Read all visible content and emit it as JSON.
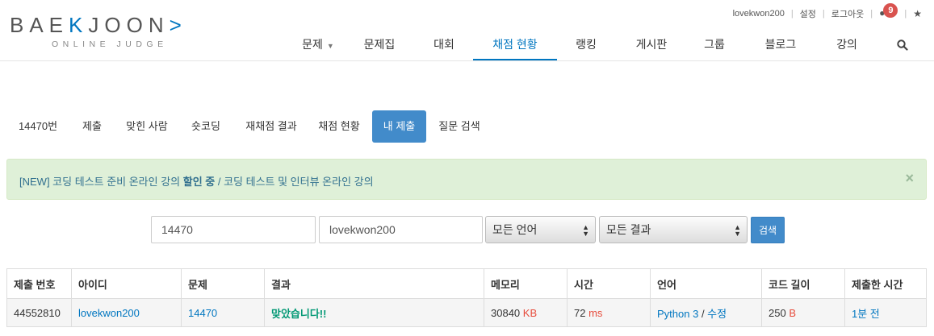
{
  "brand": {
    "logo_left": "BAE",
    "logo_k": "K",
    "logo_right": "JOON",
    "logo_arrow": ">",
    "subtitle": "ONLINE JUDGE"
  },
  "user_bar": {
    "username": "lovekwon200",
    "settings": "설정",
    "logout": "로그아웃",
    "notification_count": "9"
  },
  "nav": {
    "items": [
      "문제",
      "문제집",
      "대회",
      "채점 현황",
      "랭킹",
      "게시판",
      "그룹",
      "블로그",
      "강의"
    ],
    "active": "채점 현황"
  },
  "problem_menu": {
    "items": [
      "14470번",
      "제출",
      "맞힌 사람",
      "숏코딩",
      "재채점 결과",
      "채점 현황",
      "내 제출",
      "질문 검색"
    ],
    "active": "내 제출"
  },
  "alert": {
    "prefix": "[NEW] 코딩 테스트 준비 온라인 강의 ",
    "highlight": "할인 중",
    "suffix": " / 코딩 테스트 및 인터뷰 온라인 강의",
    "close": "×"
  },
  "filters": {
    "problem_id": "14470",
    "user_id": "lovekwon200",
    "language": "모든 언어",
    "result": "모든 결과",
    "search_button": "검색"
  },
  "table": {
    "headers": [
      "제출 번호",
      "아이디",
      "문제",
      "결과",
      "메모리",
      "시간",
      "언어",
      "코드 길이",
      "제출한 시간"
    ],
    "rows": [
      {
        "submission_id": "44552810",
        "user": "lovekwon200",
        "problem": "14470",
        "result": "맞았습니다!!",
        "memory": "30840",
        "memory_unit": "KB",
        "time": "72",
        "time_unit": "ms",
        "language": "Python 3",
        "language_sep": " / ",
        "edit": "수정",
        "code_length": "250",
        "code_unit": "B",
        "submitted": "1분 전"
      }
    ]
  },
  "colors": {
    "accent": "#0076c0",
    "active_tab": "#428bca",
    "success": "#009874",
    "unit_red": "#e74c3c",
    "alert_bg": "#dff0d8"
  }
}
